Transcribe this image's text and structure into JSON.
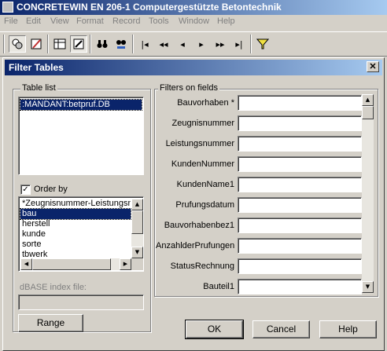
{
  "app": {
    "title": "CONCRETEWIN EN 206-1  Computergestützte Betontechnik"
  },
  "menu": [
    "File",
    "Edit",
    "View",
    "Format",
    "Record",
    "Tools",
    "Window",
    "Help"
  ],
  "toolbar": {
    "buttons": [
      {
        "icon": "filter-table-icon"
      },
      {
        "icon": "edit-pencil-icon"
      },
      {
        "icon": "grid-view-icon"
      },
      {
        "icon": "form-view-icon"
      },
      {
        "icon": "find-binoculars-icon"
      },
      {
        "icon": "find-replace-icon"
      },
      {
        "icon": "first-record-icon"
      },
      {
        "icon": "rewind-icon"
      },
      {
        "icon": "prev-record-icon"
      },
      {
        "icon": "next-record-icon"
      },
      {
        "icon": "fast-forward-icon"
      },
      {
        "icon": "last-record-icon"
      },
      {
        "icon": "filter-funnel-icon"
      }
    ]
  },
  "dialog": {
    "title": "Filter Tables",
    "close_glyph": "✕",
    "table_list": {
      "label": "Table list",
      "items": [
        ":MANDANT:betpruf.DB"
      ],
      "selected_index": 0
    },
    "order_by": {
      "label": "Order by",
      "checked": true,
      "check_glyph": "✓",
      "items": [
        "*Zeugnisnummer-Leistungsnu",
        "bau",
        "herstell",
        "kunde",
        "sorte",
        "tbwerk"
      ],
      "selected_index": 1
    },
    "dbase_index": {
      "label": "dBASE index file:",
      "value": ""
    },
    "range_button": "Range",
    "filters": {
      "label": "Filters on fields",
      "fields": [
        {
          "label": "Bauvorhaben *",
          "value": ""
        },
        {
          "label": "Zeugnisnummer",
          "value": ""
        },
        {
          "label": "Leistungsnummer",
          "value": ""
        },
        {
          "label": "KundenNummer",
          "value": ""
        },
        {
          "label": "KundenName1",
          "value": ""
        },
        {
          "label": "Prufungsdatum",
          "value": ""
        },
        {
          "label": "Bauvorhabenbez1",
          "value": ""
        },
        {
          "label": "AnzahlderPrufungen",
          "value": ""
        },
        {
          "label": "StatusRechnung",
          "value": ""
        },
        {
          "label": "Bauteil1",
          "value": ""
        }
      ]
    },
    "buttons": {
      "ok": "OK",
      "cancel": "Cancel",
      "help": "Help"
    }
  },
  "colors": {
    "title_bar": "#0a246a",
    "face": "#d4d0c8",
    "selection": "#0a246a"
  }
}
